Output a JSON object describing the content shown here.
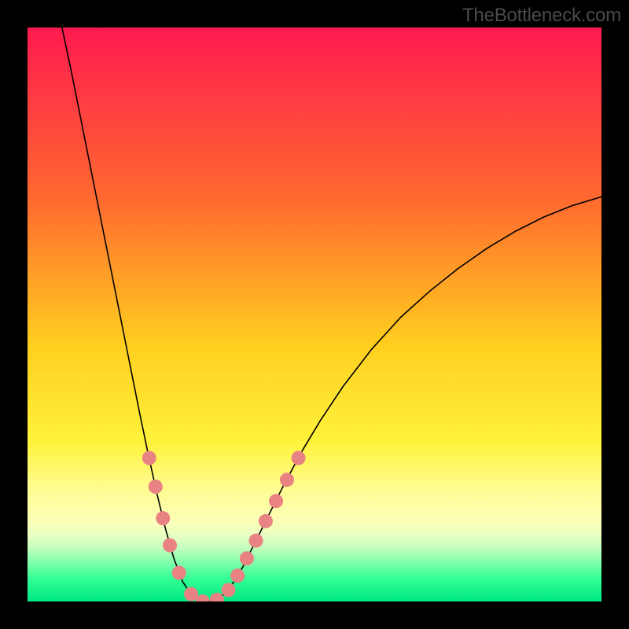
{
  "watermark": {
    "text": "TheBottleneck.com"
  },
  "chart_data": {
    "type": "line",
    "title": "",
    "xlabel": "",
    "ylabel": "",
    "xlim": [
      0,
      100
    ],
    "ylim": [
      0,
      100
    ],
    "background_gradient": {
      "stops": [
        {
          "offset": 0.0,
          "color": "#ff1a4f"
        },
        {
          "offset": 0.3,
          "color": "#ff6a2f"
        },
        {
          "offset": 0.55,
          "color": "#ffce1f"
        },
        {
          "offset": 0.72,
          "color": "#fff23a"
        },
        {
          "offset": 0.8,
          "color": "#fffc8e"
        },
        {
          "offset": 0.86,
          "color": "#fcffb7"
        },
        {
          "offset": 0.885,
          "color": "#e8ffc2"
        },
        {
          "offset": 0.905,
          "color": "#c7ffbe"
        },
        {
          "offset": 0.93,
          "color": "#86ffad"
        },
        {
          "offset": 0.96,
          "color": "#33ff95"
        },
        {
          "offset": 1.0,
          "color": "#00e884"
        }
      ]
    },
    "series": [
      {
        "name": "bottleneck-curve",
        "color": "#000000",
        "width": 1.6,
        "points": [
          {
            "x": 6.0,
            "y": 100.0
          },
          {
            "x": 7.5,
            "y": 93.0
          },
          {
            "x": 9.0,
            "y": 85.5
          },
          {
            "x": 10.5,
            "y": 78.0
          },
          {
            "x": 12.0,
            "y": 70.5
          },
          {
            "x": 13.5,
            "y": 63.0
          },
          {
            "x": 15.0,
            "y": 55.5
          },
          {
            "x": 16.5,
            "y": 48.0
          },
          {
            "x": 18.0,
            "y": 40.5
          },
          {
            "x": 19.5,
            "y": 33.0
          },
          {
            "x": 21.0,
            "y": 25.8
          },
          {
            "x": 22.5,
            "y": 19.0
          },
          {
            "x": 24.0,
            "y": 12.8
          },
          {
            "x": 25.5,
            "y": 7.5
          },
          {
            "x": 27.0,
            "y": 3.5
          },
          {
            "x": 28.5,
            "y": 1.2
          },
          {
            "x": 30.0,
            "y": 0.0
          },
          {
            "x": 31.5,
            "y": 0.0
          },
          {
            "x": 33.0,
            "y": 0.3
          },
          {
            "x": 34.5,
            "y": 1.5
          },
          {
            "x": 36.0,
            "y": 3.5
          },
          {
            "x": 37.5,
            "y": 6.0
          },
          {
            "x": 39.0,
            "y": 9.0
          },
          {
            "x": 41.0,
            "y": 13.0
          },
          {
            "x": 43.0,
            "y": 17.0
          },
          {
            "x": 45.0,
            "y": 21.0
          },
          {
            "x": 48.0,
            "y": 26.5
          },
          {
            "x": 51.0,
            "y": 31.5
          },
          {
            "x": 55.0,
            "y": 37.5
          },
          {
            "x": 60.0,
            "y": 44.0
          },
          {
            "x": 65.0,
            "y": 49.5
          },
          {
            "x": 70.0,
            "y": 54.0
          },
          {
            "x": 75.0,
            "y": 58.0
          },
          {
            "x": 80.0,
            "y": 61.5
          },
          {
            "x": 85.0,
            "y": 64.5
          },
          {
            "x": 90.0,
            "y": 67.0
          },
          {
            "x": 95.0,
            "y": 69.0
          },
          {
            "x": 100.0,
            "y": 70.5
          }
        ]
      }
    ],
    "markers": {
      "name": "highlight-dots",
      "color": "#e98282",
      "radius": 9,
      "points": [
        {
          "x": 21.2,
          "y": 25.0
        },
        {
          "x": 22.3,
          "y": 20.0
        },
        {
          "x": 23.6,
          "y": 14.5
        },
        {
          "x": 24.8,
          "y": 9.8
        },
        {
          "x": 26.4,
          "y": 5.0
        },
        {
          "x": 28.5,
          "y": 1.3
        },
        {
          "x": 30.5,
          "y": 0.0
        },
        {
          "x": 33.0,
          "y": 0.3
        },
        {
          "x": 35.0,
          "y": 2.0
        },
        {
          "x": 36.6,
          "y": 4.5
        },
        {
          "x": 38.2,
          "y": 7.5
        },
        {
          "x": 39.8,
          "y": 10.6
        },
        {
          "x": 41.5,
          "y": 14.0
        },
        {
          "x": 43.3,
          "y": 17.5
        },
        {
          "x": 45.2,
          "y": 21.2
        },
        {
          "x": 47.2,
          "y": 25.0
        }
      ]
    }
  }
}
